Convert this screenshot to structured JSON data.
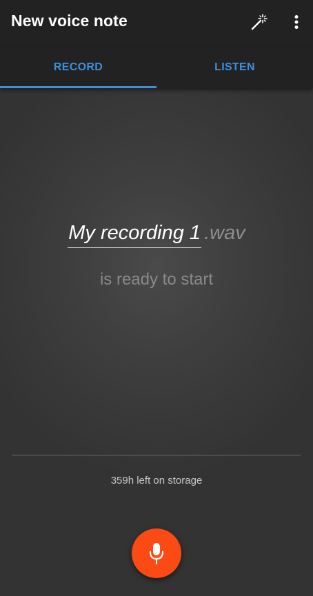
{
  "app_bar": {
    "title": "New voice note",
    "icons": [
      "magic-wand-icon",
      "more-vert-icon"
    ]
  },
  "tabs": [
    {
      "label": "RECORD",
      "selected": true
    },
    {
      "label": "LISTEN",
      "selected": false
    }
  ],
  "recording": {
    "filename": "My recording 1",
    "extension": ".wav",
    "status": "is ready to start"
  },
  "storage": {
    "text": "359h left on storage"
  },
  "record_button": {
    "icon": "microphone-icon"
  },
  "colors": {
    "accent": "#3d8fdb",
    "record": "#fc4a15",
    "background": "#222222"
  }
}
